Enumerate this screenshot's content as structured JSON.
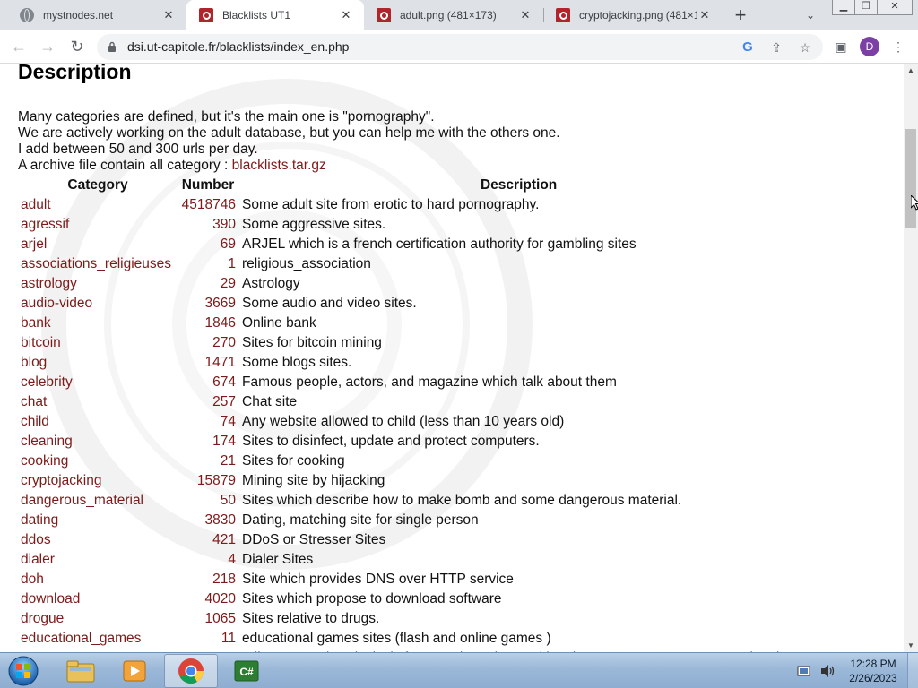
{
  "browser": {
    "tabs": [
      {
        "title": "mystnodes.net",
        "icon": "globe-icon",
        "active": false
      },
      {
        "title": "Blacklists UT1",
        "icon": "ut1-favicon-icon",
        "active": true
      },
      {
        "title": "adult.png (481×173)",
        "icon": "ut1-favicon-icon",
        "active": false
      },
      {
        "title": "cryptojacking.png (481×1",
        "icon": "ut1-favicon-icon",
        "active": false
      }
    ],
    "url": "dsi.ut-capitole.fr/blacklists/index_en.php",
    "profile_initial": "D"
  },
  "page": {
    "heading": "Description",
    "intro": [
      "Many categories are defined, but it's the main one is \"pornography\".",
      "We are actively working on the adult database, but you can help me with the others one.",
      "I add between 50 and 300 urls per day."
    ],
    "archive_text": "A archive file contain all category : ",
    "archive_link": "blacklists.tar.gz",
    "table": {
      "headers": [
        "Category",
        "Number",
        "Description"
      ],
      "rows": [
        {
          "category": "adult",
          "number": "4518746",
          "description": "Some adult site from erotic to hard pornography."
        },
        {
          "category": "agressif",
          "number": "390",
          "description": "Some aggressive sites."
        },
        {
          "category": "arjel",
          "number": "69",
          "description": "ARJEL which is a french certification authority for gambling sites"
        },
        {
          "category": "associations_religieuses",
          "number": "1",
          "description": "religious_association"
        },
        {
          "category": "astrology",
          "number": "29",
          "description": "Astrology"
        },
        {
          "category": "audio-video",
          "number": "3669",
          "description": "Some audio and video sites."
        },
        {
          "category": "bank",
          "number": "1846",
          "description": "Online bank"
        },
        {
          "category": "bitcoin",
          "number": "270",
          "description": "Sites for bitcoin mining"
        },
        {
          "category": "blog",
          "number": "1471",
          "description": "Some blogs sites."
        },
        {
          "category": "celebrity",
          "number": "674",
          "description": "Famous people, actors, and magazine which talk about them"
        },
        {
          "category": "chat",
          "number": "257",
          "description": "Chat site"
        },
        {
          "category": "child",
          "number": "74",
          "description": "Any website allowed to child (less than 10 years old)"
        },
        {
          "category": "cleaning",
          "number": "174",
          "description": "Sites to disinfect, update and protect computers."
        },
        {
          "category": "cooking",
          "number": "21",
          "description": "Sites for cooking"
        },
        {
          "category": "cryptojacking",
          "number": "15879",
          "description": "Mining site by hijacking"
        },
        {
          "category": "dangerous_material",
          "number": "50",
          "description": "Sites which describe how to make bomb and some dangerous material."
        },
        {
          "category": "dating",
          "number": "3830",
          "description": "Dating, matching site for single person"
        },
        {
          "category": "ddos",
          "number": "421",
          "description": "DDoS or Stresser Sites"
        },
        {
          "category": "dialer",
          "number": "4",
          "description": "Dialer Sites"
        },
        {
          "category": "doh",
          "number": "218",
          "description": "Site which provides DNS over HTTP service"
        },
        {
          "category": "download",
          "number": "4020",
          "description": "Sites which propose to download software"
        },
        {
          "category": "drogue",
          "number": "1065",
          "description": "Sites relative to drugs."
        },
        {
          "category": "educational_games",
          "number": "11",
          "description": "educational games sites (flash and online games )"
        },
        {
          "category": "",
          "number": "",
          "description": "A list reserved exclusively for French students taking the PIX exam. DO NOT USE in other"
        }
      ]
    }
  },
  "taskbar": {
    "time": "12:28 PM",
    "date": "2/26/2023",
    "apps": [
      "windows-explorer-icon",
      "media-player-icon",
      "chrome-icon",
      "csharp-editor-icon"
    ]
  },
  "colors": {
    "link": "#7d1a1a",
    "tabstrip": "#dee1e6",
    "taskbar": "#9bb8d8",
    "brand": "#b0242c"
  }
}
